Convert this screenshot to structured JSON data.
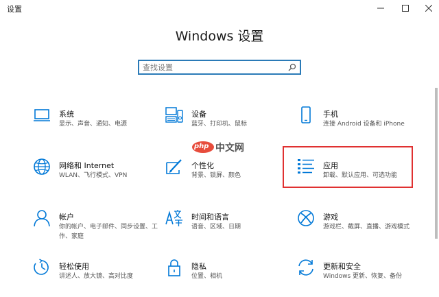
{
  "window": {
    "title": "设置"
  },
  "page": {
    "title": "Windows 设置"
  },
  "search": {
    "placeholder": "查找设置",
    "value": ""
  },
  "tiles": [
    {
      "title": "系统",
      "desc": "显示、声音、通知、电源",
      "icon": "laptop-icon"
    },
    {
      "title": "设备",
      "desc": "蓝牙、打印机、鼠标",
      "icon": "devices-icon"
    },
    {
      "title": "手机",
      "desc": "连接 Android 设备和 iPhone",
      "icon": "phone-icon"
    },
    {
      "title": "网络和 Internet",
      "desc": "WLAN、飞行模式、VPN",
      "icon": "globe-icon"
    },
    {
      "title": "个性化",
      "desc": "背景、锁屏、颜色",
      "icon": "personalization-icon"
    },
    {
      "title": "应用",
      "desc": "卸载、默认应用、可选功能",
      "icon": "apps-list-icon"
    },
    {
      "title": "帐户",
      "desc": "你的帐户、电子邮件、同步设置、工作、家庭",
      "icon": "person-icon"
    },
    {
      "title": "时间和语言",
      "desc": "语音、区域、日期",
      "icon": "time-language-icon"
    },
    {
      "title": "游戏",
      "desc": "游戏栏、截屏、直播、游戏模式",
      "icon": "xbox-icon"
    },
    {
      "title": "轻松使用",
      "desc": "讲述人、放大镜、高对比度",
      "icon": "ease-of-access-icon"
    },
    {
      "title": "隐私",
      "desc": "位置、相机",
      "icon": "lock-icon"
    },
    {
      "title": "更新和安全",
      "desc": "Windows 更新、恢复、备份",
      "icon": "update-icon"
    }
  ],
  "watermark": {
    "logo": "php",
    "text": "中文网"
  },
  "colors": {
    "accent": "#0078d7",
    "search_border": "#2a7ab7",
    "highlight": "#e03131"
  }
}
